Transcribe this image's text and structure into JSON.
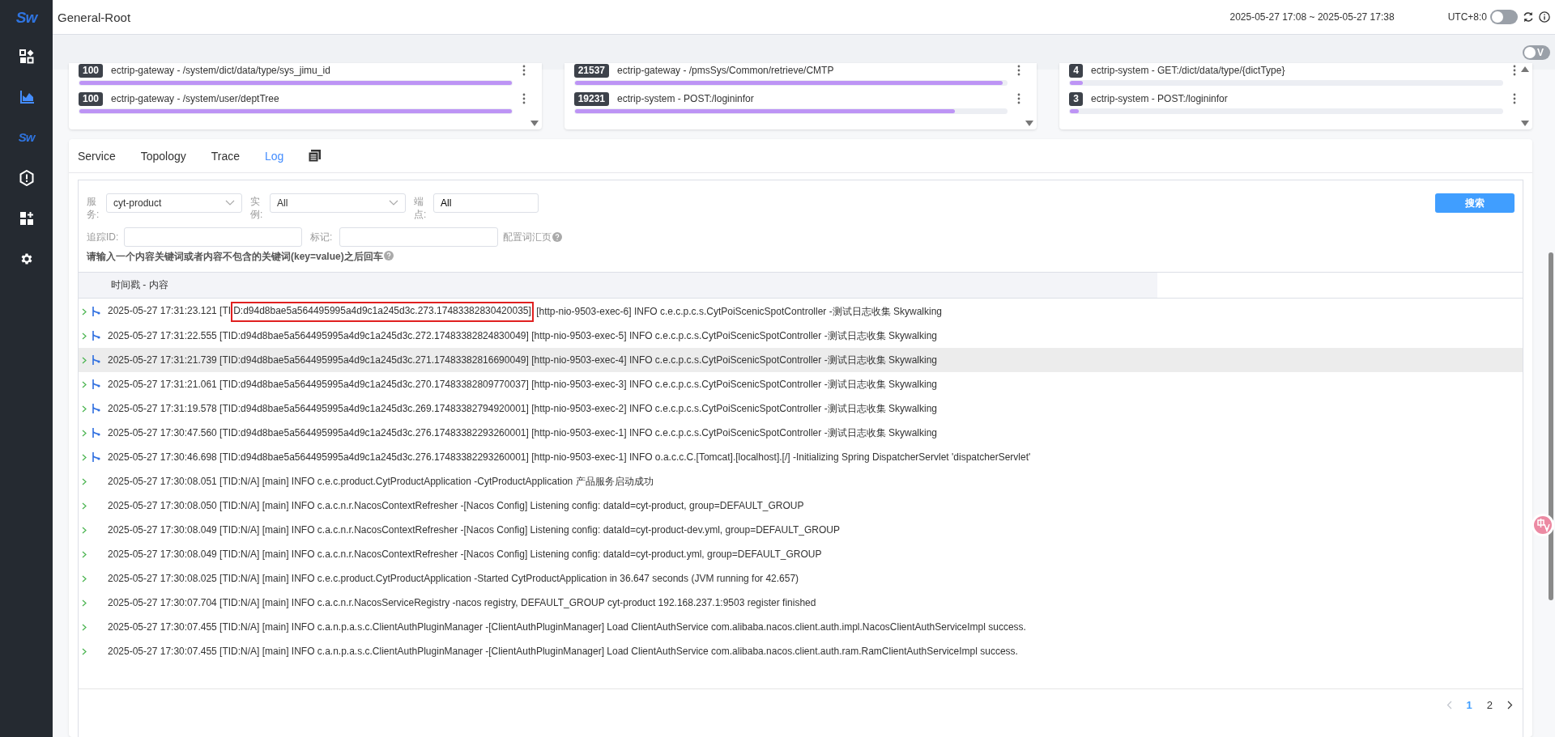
{
  "sidebar": {
    "logo": "Sw",
    "items": [
      {
        "kind": "shapes",
        "selected": false
      },
      {
        "kind": "chart",
        "selected": true
      },
      {
        "kind": "logo",
        "text": "Sw",
        "selected": false
      },
      {
        "kind": "hexagon",
        "selected": false
      },
      {
        "kind": "grid-plus",
        "selected": false
      },
      {
        "kind": "settings",
        "selected": false
      }
    ]
  },
  "header": {
    "title": "General-Root",
    "time_range": "2025-05-27 17:08 ~ 2025-05-27 17:38",
    "timezone": "UTC+8:0",
    "auto_refresh_on": false
  },
  "toolbar": {
    "toggle_label": "V",
    "toggle_on": false
  },
  "top_cards": [
    {
      "scroll_up": false,
      "rows": [
        {
          "count": "100",
          "label": "ectrip-gateway - /system/dict/data/type/sys_jimu_id",
          "level": 1
        },
        {
          "count": "100",
          "label": "ectrip-gateway - /system/user/deptTree",
          "level": 1
        }
      ]
    },
    {
      "scroll_up": false,
      "rows": [
        {
          "count": "21537",
          "label": "ectrip-gateway - /pmsSys/Common/retrieve/CMTP",
          "level": 0.99
        },
        {
          "count": "19231",
          "label": "ectrip-system - POST:/logininfor",
          "level": 0.88
        }
      ]
    },
    {
      "scroll_up": true,
      "rows": [
        {
          "count": "4",
          "label": "ectrip-system - GET:/dict/data/type/{dictType}",
          "level": 0.03
        },
        {
          "count": "3",
          "label": "ectrip-system - POST:/logininfor",
          "level": 0.02
        }
      ]
    }
  ],
  "tabs": [
    {
      "label": "Service",
      "selected": false
    },
    {
      "label": "Topology",
      "selected": false
    },
    {
      "label": "Trace",
      "selected": false
    },
    {
      "label": "Log",
      "selected": true
    }
  ],
  "filters": {
    "service_label": "服务:",
    "service_value": "cyt-product",
    "instance_label": "实例:",
    "instance_value": "All",
    "endpoint_label": "端点:",
    "endpoint_value": "All",
    "trace_label": "追踪ID:",
    "tag_label": "标记:",
    "glossary_link": "配置词汇页",
    "hint": "请输入一个内容关键词或者内容不包含的关键词(key=value)之后回车",
    "search_button": "搜索"
  },
  "table": {
    "column": "时间戳 - 内容",
    "rows": [
      {
        "kind": "trace",
        "highlighted": false,
        "segments": [
          {
            "text": "2025-05-27 17:31:23.121 [TI",
            "boxed": false
          },
          {
            "text": "D:d94d8bae5a564495995a4d9c1a245d3c.273.17483382830420035]",
            "boxed": true
          },
          {
            "text": " [http-nio-9503-exec-6] INFO c.e.c.p.c.s.CytPoiScenicSpotController -测试日志收集 Skywalking",
            "boxed": false
          }
        ]
      },
      {
        "kind": "trace",
        "highlighted": false,
        "segments": [
          {
            "text": "2025-05-27 17:31:22.555 [TID:d94d8bae5a564495995a4d9c1a245d3c.272.17483382824830049] [http-nio-9503-exec-5] INFO c.e.c.p.c.s.CytPoiScenicSpotController -测试日志收集 Skywalking",
            "boxed": false
          }
        ]
      },
      {
        "kind": "trace",
        "highlighted": true,
        "segments": [
          {
            "text": "2025-05-27 17:31:21.739 [TID:d94d8bae5a564495995a4d9c1a245d3c.271.17483382816690049] [http-nio-9503-exec-4] INFO c.e.c.p.c.s.CytPoiScenicSpotController -测试日志收集 Skywalking",
            "boxed": false
          }
        ]
      },
      {
        "kind": "trace",
        "highlighted": false,
        "segments": [
          {
            "text": "2025-05-27 17:31:21.061 [TID:d94d8bae5a564495995a4d9c1a245d3c.270.17483382809770037] [http-nio-9503-exec-3] INFO c.e.c.p.c.s.CytPoiScenicSpotController -测试日志收集 Skywalking",
            "boxed": false
          }
        ]
      },
      {
        "kind": "trace",
        "highlighted": false,
        "segments": [
          {
            "text": "2025-05-27 17:31:19.578 [TID:d94d8bae5a564495995a4d9c1a245d3c.269.17483382794920001] [http-nio-9503-exec-2] INFO c.e.c.p.c.s.CytPoiScenicSpotController -测试日志收集 Skywalking",
            "boxed": false
          }
        ]
      },
      {
        "kind": "trace",
        "highlighted": false,
        "segments": [
          {
            "text": "2025-05-27 17:30:47.560 [TID:d94d8bae5a564495995a4d9c1a245d3c.276.17483382293260001] [http-nio-9503-exec-1] INFO c.e.c.p.c.s.CytPoiScenicSpotController -测试日志收集 Skywalking",
            "boxed": false
          }
        ]
      },
      {
        "kind": "trace",
        "highlighted": false,
        "segments": [
          {
            "text": "2025-05-27 17:30:46.698 [TID:d94d8bae5a564495995a4d9c1a245d3c.276.17483382293260001] [http-nio-9503-exec-1] INFO o.a.c.c.C.[Tomcat].[localhost].[/] -Initializing Spring DispatcherServlet 'dispatcherServlet'",
            "boxed": false
          }
        ]
      },
      {
        "kind": "plain",
        "highlighted": false,
        "segments": [
          {
            "text": "2025-05-27 17:30:08.051 [TID:N/A] [main] INFO c.e.c.product.CytProductApplication -CytProductApplication 产品服务启动成功",
            "boxed": false
          }
        ]
      },
      {
        "kind": "plain",
        "highlighted": false,
        "segments": [
          {
            "text": "2025-05-27 17:30:08.050 [TID:N/A] [main] INFO c.a.c.n.r.NacosContextRefresher -[Nacos Config] Listening config: dataId=cyt-product, group=DEFAULT_GROUP",
            "boxed": false
          }
        ]
      },
      {
        "kind": "plain",
        "highlighted": false,
        "segments": [
          {
            "text": "2025-05-27 17:30:08.049 [TID:N/A] [main] INFO c.a.c.n.r.NacosContextRefresher -[Nacos Config] Listening config: dataId=cyt-product-dev.yml, group=DEFAULT_GROUP",
            "boxed": false
          }
        ]
      },
      {
        "kind": "plain",
        "highlighted": false,
        "segments": [
          {
            "text": "2025-05-27 17:30:08.049 [TID:N/A] [main] INFO c.a.c.n.r.NacosContextRefresher -[Nacos Config] Listening config: dataId=cyt-product.yml, group=DEFAULT_GROUP",
            "boxed": false
          }
        ]
      },
      {
        "kind": "plain",
        "highlighted": false,
        "segments": [
          {
            "text": "2025-05-27 17:30:08.025 [TID:N/A] [main] INFO c.e.c.product.CytProductApplication -Started CytProductApplication in 36.647 seconds (JVM running for 42.657)",
            "boxed": false
          }
        ]
      },
      {
        "kind": "plain",
        "highlighted": false,
        "segments": [
          {
            "text": "2025-05-27 17:30:07.704 [TID:N/A] [main] INFO c.a.c.n.r.NacosServiceRegistry -nacos registry, DEFAULT_GROUP cyt-product 192.168.237.1:9503 register finished",
            "boxed": false
          }
        ]
      },
      {
        "kind": "plain",
        "highlighted": false,
        "segments": [
          {
            "text": "2025-05-27 17:30:07.455 [TID:N/A] [main] INFO c.a.n.p.a.s.c.ClientAuthPluginManager -[ClientAuthPluginManager] Load ClientAuthService com.alibaba.nacos.client.auth.impl.NacosClientAuthServiceImpl success.",
            "boxed": false
          }
        ]
      },
      {
        "kind": "plain",
        "highlighted": false,
        "segments": [
          {
            "text": "2025-05-27 17:30:07.455 [TID:N/A] [main] INFO c.a.n.p.a.s.c.ClientAuthPluginManager -[ClientAuthPluginManager] Load ClientAuthService com.alibaba.nacos.client.auth.ram.RamClientAuthServiceImpl success.",
            "boxed": false
          }
        ]
      }
    ]
  },
  "pagination": {
    "prev_disabled": true,
    "pages": [
      {
        "label": "1",
        "selected": true
      },
      {
        "label": "2",
        "selected": false
      }
    ]
  }
}
